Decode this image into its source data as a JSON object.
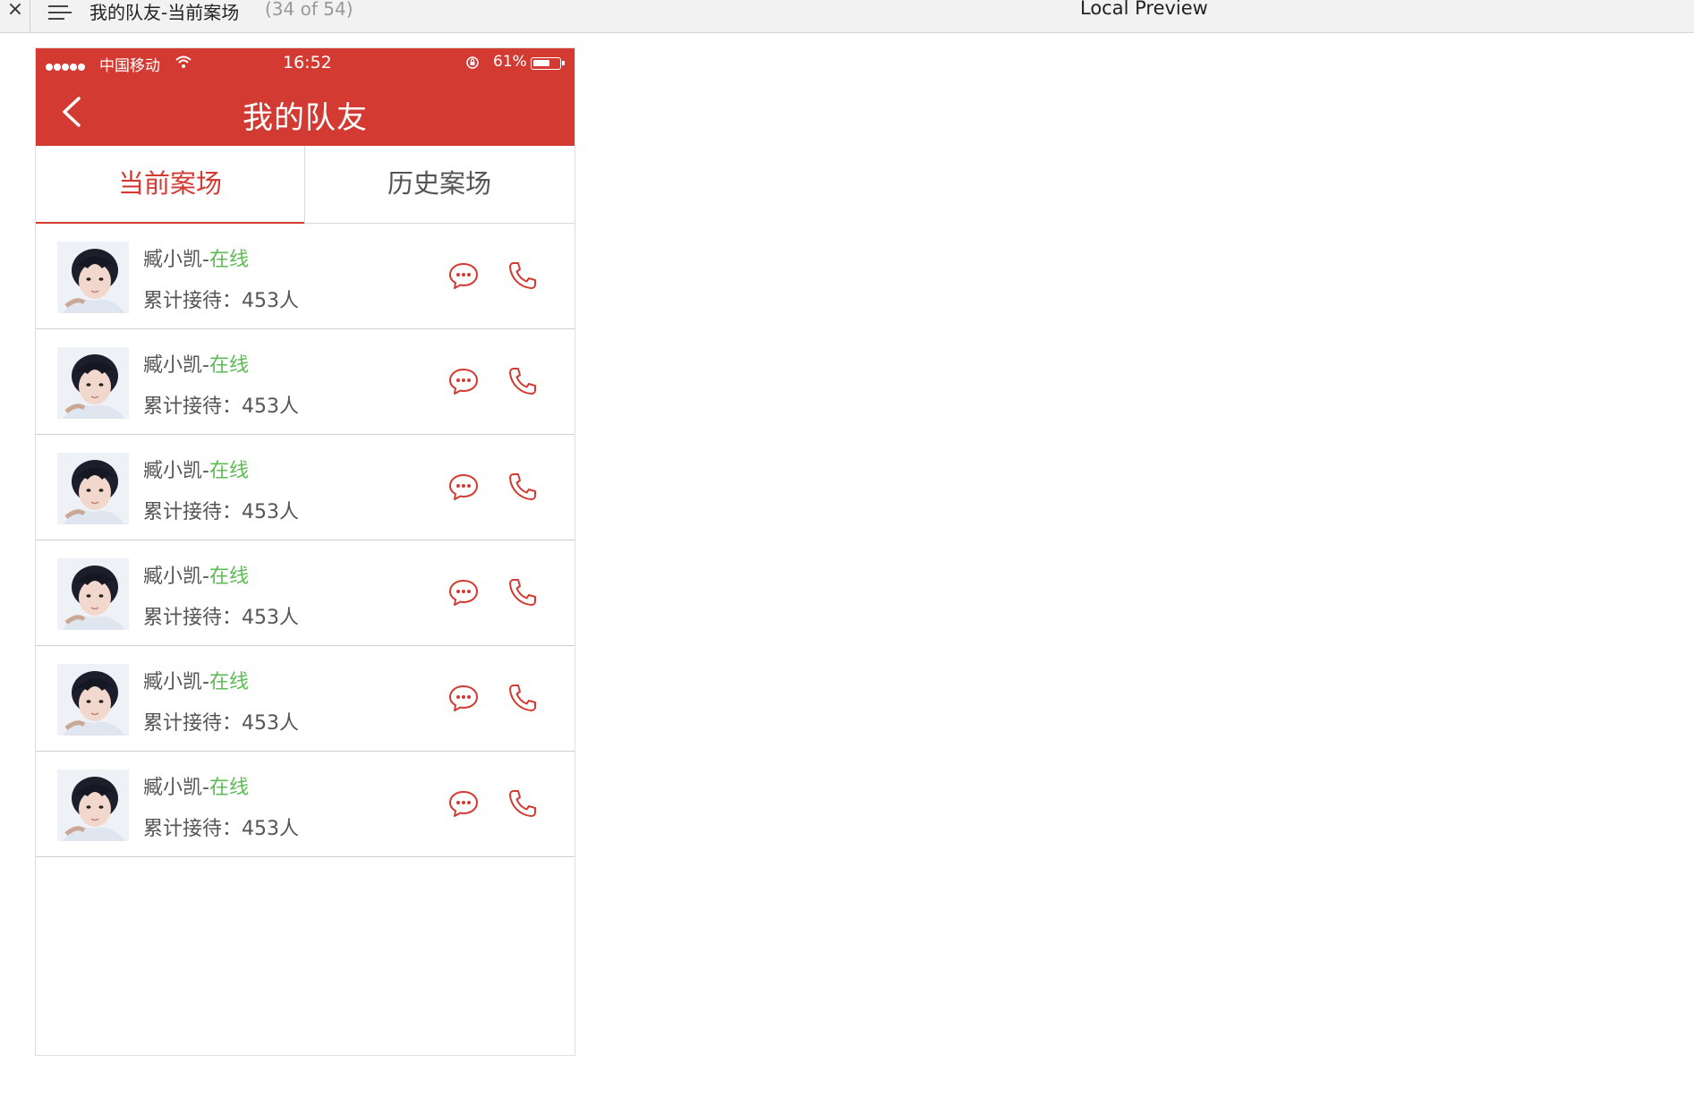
{
  "window": {
    "close_glyph": "×",
    "title": "我的队友-当前案场",
    "counter": "(34 of 54)",
    "preview_label": "Local Preview"
  },
  "status_bar": {
    "carrier": "中国移动",
    "time": "16:52",
    "battery": "61%"
  },
  "header": {
    "title": "我的队友",
    "color": "#d33b32"
  },
  "tabs": [
    {
      "label": "当前案场",
      "active": true
    },
    {
      "label": "历史案场",
      "active": false
    }
  ],
  "teammates": [
    {
      "name": "臧小凯",
      "separator": "-",
      "status": "在线",
      "stat_label": "累计接待：",
      "stat_value": "453人"
    },
    {
      "name": "臧小凯",
      "separator": "-",
      "status": "在线",
      "stat_label": "累计接待：",
      "stat_value": "453人"
    },
    {
      "name": "臧小凯",
      "separator": "-",
      "status": "在线",
      "stat_label": "累计接待：",
      "stat_value": "453人"
    },
    {
      "name": "臧小凯",
      "separator": "-",
      "status": "在线",
      "stat_label": "累计接待：",
      "stat_value": "453人"
    },
    {
      "name": "臧小凯",
      "separator": "-",
      "status": "在线",
      "stat_label": "累计接待：",
      "stat_value": "453人"
    },
    {
      "name": "臧小凯",
      "separator": "-",
      "status": "在线",
      "stat_label": "累计接待：",
      "stat_value": "453人"
    }
  ],
  "icons": {
    "back": "back-arrow-icon",
    "chat": "chat-bubble-icon",
    "call": "phone-icon"
  },
  "colors": {
    "accent": "#d33b32",
    "online": "#5dbb54"
  }
}
